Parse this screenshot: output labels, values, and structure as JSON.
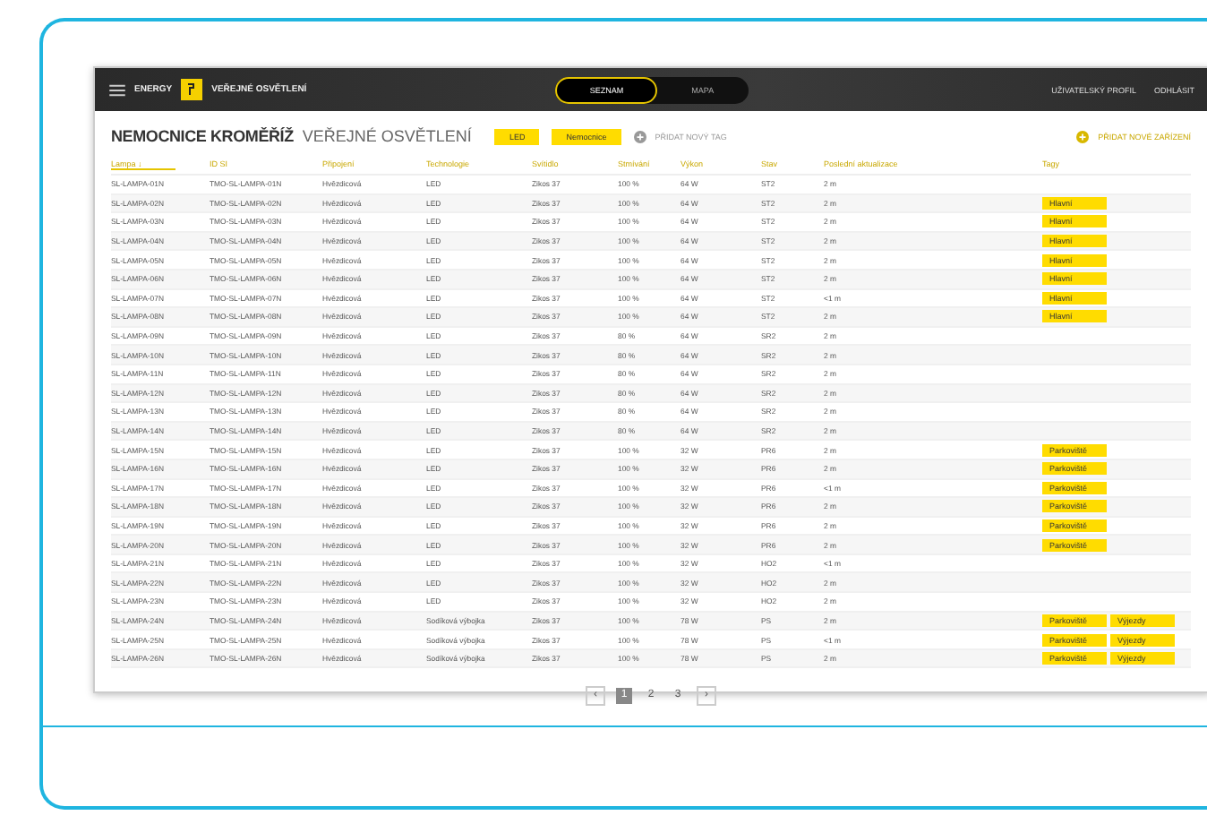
{
  "header": {
    "app": "ENERGY",
    "module": "VEŘEJNÉ OSVĚTLENÍ",
    "views": [
      {
        "label": "SEZNAM",
        "selected": true
      },
      {
        "label": "MAPA",
        "selected": false
      }
    ],
    "links": [
      "UŽIVATELSKÝ PROFIL",
      "ODHLÁSIT"
    ]
  },
  "title": {
    "location": "NEMOCNICE KROMĚŘÍŽ",
    "section": "VEŘEJNÉ OSVĚTLENÍ",
    "tags": [
      "LED",
      "Nemocnice"
    ],
    "add_tag": "PŘIDAT NOVÝ TAG",
    "add_device": "PŘIDAT NOVÉ ZAŘÍZENÍ"
  },
  "table": {
    "columns": [
      "Lampa ↓",
      "ID SI",
      "Připojení",
      "Technologie",
      "Svítidlo",
      "Stmívání",
      "Výkon",
      "Stav",
      "Poslední aktualizace",
      "Tagy"
    ],
    "rows": [
      {
        "cells": [
          "SL-LAMPA-01N",
          "TMO-SL-LAMPA-01N",
          "Hvězdicová",
          "LED",
          "Zikos 37",
          "100 %",
          "64 W",
          "ST2",
          "2 m"
        ],
        "tags": []
      },
      {
        "cells": [
          "SL-LAMPA-02N",
          "TMO-SL-LAMPA-02N",
          "Hvězdicová",
          "LED",
          "Zikos 37",
          "100 %",
          "64 W",
          "ST2",
          "2 m"
        ],
        "tags": [
          "Hlavní"
        ]
      },
      {
        "cells": [
          "SL-LAMPA-03N",
          "TMO-SL-LAMPA-03N",
          "Hvězdicová",
          "LED",
          "Zikos 37",
          "100 %",
          "64 W",
          "ST2",
          "2 m"
        ],
        "tags": [
          "Hlavní"
        ]
      },
      {
        "cells": [
          "SL-LAMPA-04N",
          "TMO-SL-LAMPA-04N",
          "Hvězdicová",
          "LED",
          "Zikos 37",
          "100 %",
          "64 W",
          "ST2",
          "2 m"
        ],
        "tags": [
          "Hlavní"
        ]
      },
      {
        "cells": [
          "SL-LAMPA-05N",
          "TMO-SL-LAMPA-05N",
          "Hvězdicová",
          "LED",
          "Zikos 37",
          "100 %",
          "64 W",
          "ST2",
          "2 m"
        ],
        "tags": [
          "Hlavní"
        ]
      },
      {
        "cells": [
          "SL-LAMPA-06N",
          "TMO-SL-LAMPA-06N",
          "Hvězdicová",
          "LED",
          "Zikos 37",
          "100 %",
          "64 W",
          "ST2",
          "2 m"
        ],
        "tags": [
          "Hlavní"
        ]
      },
      {
        "cells": [
          "SL-LAMPA-07N",
          "TMO-SL-LAMPA-07N",
          "Hvězdicová",
          "LED",
          "Zikos 37",
          "100 %",
          "64 W",
          "ST2",
          "<1 m"
        ],
        "tags": [
          "Hlavní"
        ]
      },
      {
        "cells": [
          "SL-LAMPA-08N",
          "TMO-SL-LAMPA-08N",
          "Hvězdicová",
          "LED",
          "Zikos 37",
          "100 %",
          "64 W",
          "ST2",
          "2 m"
        ],
        "tags": [
          "Hlavní"
        ]
      },
      {
        "cells": [
          "SL-LAMPA-09N",
          "TMO-SL-LAMPA-09N",
          "Hvězdicová",
          "LED",
          "Zikos 37",
          "80 %",
          "64 W",
          "SR2",
          "2 m"
        ],
        "tags": []
      },
      {
        "cells": [
          "SL-LAMPA-10N",
          "TMO-SL-LAMPA-10N",
          "Hvězdicová",
          "LED",
          "Zikos 37",
          "80 %",
          "64 W",
          "SR2",
          "2 m"
        ],
        "tags": []
      },
      {
        "cells": [
          "SL-LAMPA-11N",
          "TMO-SL-LAMPA-11N",
          "Hvězdicová",
          "LED",
          "Zikos 37",
          "80 %",
          "64 W",
          "SR2",
          "2 m"
        ],
        "tags": []
      },
      {
        "cells": [
          "SL-LAMPA-12N",
          "TMO-SL-LAMPA-12N",
          "Hvězdicová",
          "LED",
          "Zikos 37",
          "80 %",
          "64 W",
          "SR2",
          "2 m"
        ],
        "tags": []
      },
      {
        "cells": [
          "SL-LAMPA-13N",
          "TMO-SL-LAMPA-13N",
          "Hvězdicová",
          "LED",
          "Zikos 37",
          "80 %",
          "64 W",
          "SR2",
          "2 m"
        ],
        "tags": []
      },
      {
        "cells": [
          "SL-LAMPA-14N",
          "TMO-SL-LAMPA-14N",
          "Hvězdicová",
          "LED",
          "Zikos 37",
          "80 %",
          "64 W",
          "SR2",
          "2 m"
        ],
        "tags": []
      },
      {
        "cells": [
          "SL-LAMPA-15N",
          "TMO-SL-LAMPA-15N",
          "Hvězdicová",
          "LED",
          "Zikos 37",
          "100 %",
          "32 W",
          "PR6",
          "2 m"
        ],
        "tags": [
          "Parkoviště"
        ]
      },
      {
        "cells": [
          "SL-LAMPA-16N",
          "TMO-SL-LAMPA-16N",
          "Hvězdicová",
          "LED",
          "Zikos 37",
          "100 %",
          "32 W",
          "PR6",
          "2 m"
        ],
        "tags": [
          "Parkoviště"
        ]
      },
      {
        "cells": [
          "SL-LAMPA-17N",
          "TMO-SL-LAMPA-17N",
          "Hvězdicová",
          "LED",
          "Zikos 37",
          "100 %",
          "32 W",
          "PR6",
          "<1 m"
        ],
        "tags": [
          "Parkoviště"
        ]
      },
      {
        "cells": [
          "SL-LAMPA-18N",
          "TMO-SL-LAMPA-18N",
          "Hvězdicová",
          "LED",
          "Zikos 37",
          "100 %",
          "32 W",
          "PR6",
          "2 m"
        ],
        "tags": [
          "Parkoviště"
        ]
      },
      {
        "cells": [
          "SL-LAMPA-19N",
          "TMO-SL-LAMPA-19N",
          "Hvězdicová",
          "LED",
          "Zikos 37",
          "100 %",
          "32 W",
          "PR6",
          "2 m"
        ],
        "tags": [
          "Parkoviště"
        ]
      },
      {
        "cells": [
          "SL-LAMPA-20N",
          "TMO-SL-LAMPA-20N",
          "Hvězdicová",
          "LED",
          "Zikos 37",
          "100 %",
          "32 W",
          "PR6",
          "2 m"
        ],
        "tags": [
          "Parkoviště"
        ]
      },
      {
        "cells": [
          "SL-LAMPA-21N",
          "TMO-SL-LAMPA-21N",
          "Hvězdicová",
          "LED",
          "Zikos 37",
          "100 %",
          "32 W",
          "HO2",
          "<1 m"
        ],
        "tags": []
      },
      {
        "cells": [
          "SL-LAMPA-22N",
          "TMO-SL-LAMPA-22N",
          "Hvězdicová",
          "LED",
          "Zikos 37",
          "100 %",
          "32 W",
          "HO2",
          "2 m"
        ],
        "tags": []
      },
      {
        "cells": [
          "SL-LAMPA-23N",
          "TMO-SL-LAMPA-23N",
          "Hvězdicová",
          "LED",
          "Zikos 37",
          "100 %",
          "32 W",
          "HO2",
          "2 m"
        ],
        "tags": []
      },
      {
        "cells": [
          "SL-LAMPA-24N",
          "TMO-SL-LAMPA-24N",
          "Hvězdicová",
          "Sodíková výbojka",
          "Zikos 37",
          "100 %",
          "78 W",
          "PS",
          "2 m"
        ],
        "tags": [
          "Parkoviště",
          "Výjezdy"
        ]
      },
      {
        "cells": [
          "SL-LAMPA-25N",
          "TMO-SL-LAMPA-25N",
          "Hvězdicová",
          "Sodíková výbojka",
          "Zikos 37",
          "100 %",
          "78 W",
          "PS",
          "<1 m"
        ],
        "tags": [
          "Parkoviště",
          "Výjezdy"
        ]
      },
      {
        "cells": [
          "SL-LAMPA-26N",
          "TMO-SL-LAMPA-26N",
          "Hvězdicová",
          "Sodíková výbojka",
          "Zikos 37",
          "100 %",
          "78 W",
          "PS",
          "2 m"
        ],
        "tags": [
          "Parkoviště",
          "Výjezdy"
        ]
      }
    ]
  },
  "pagination": {
    "prev": "‹",
    "pages": [
      {
        "label": "1",
        "selected": true
      },
      {
        "label": "2",
        "selected": false
      },
      {
        "label": "3",
        "selected": false
      }
    ],
    "next": "›"
  }
}
